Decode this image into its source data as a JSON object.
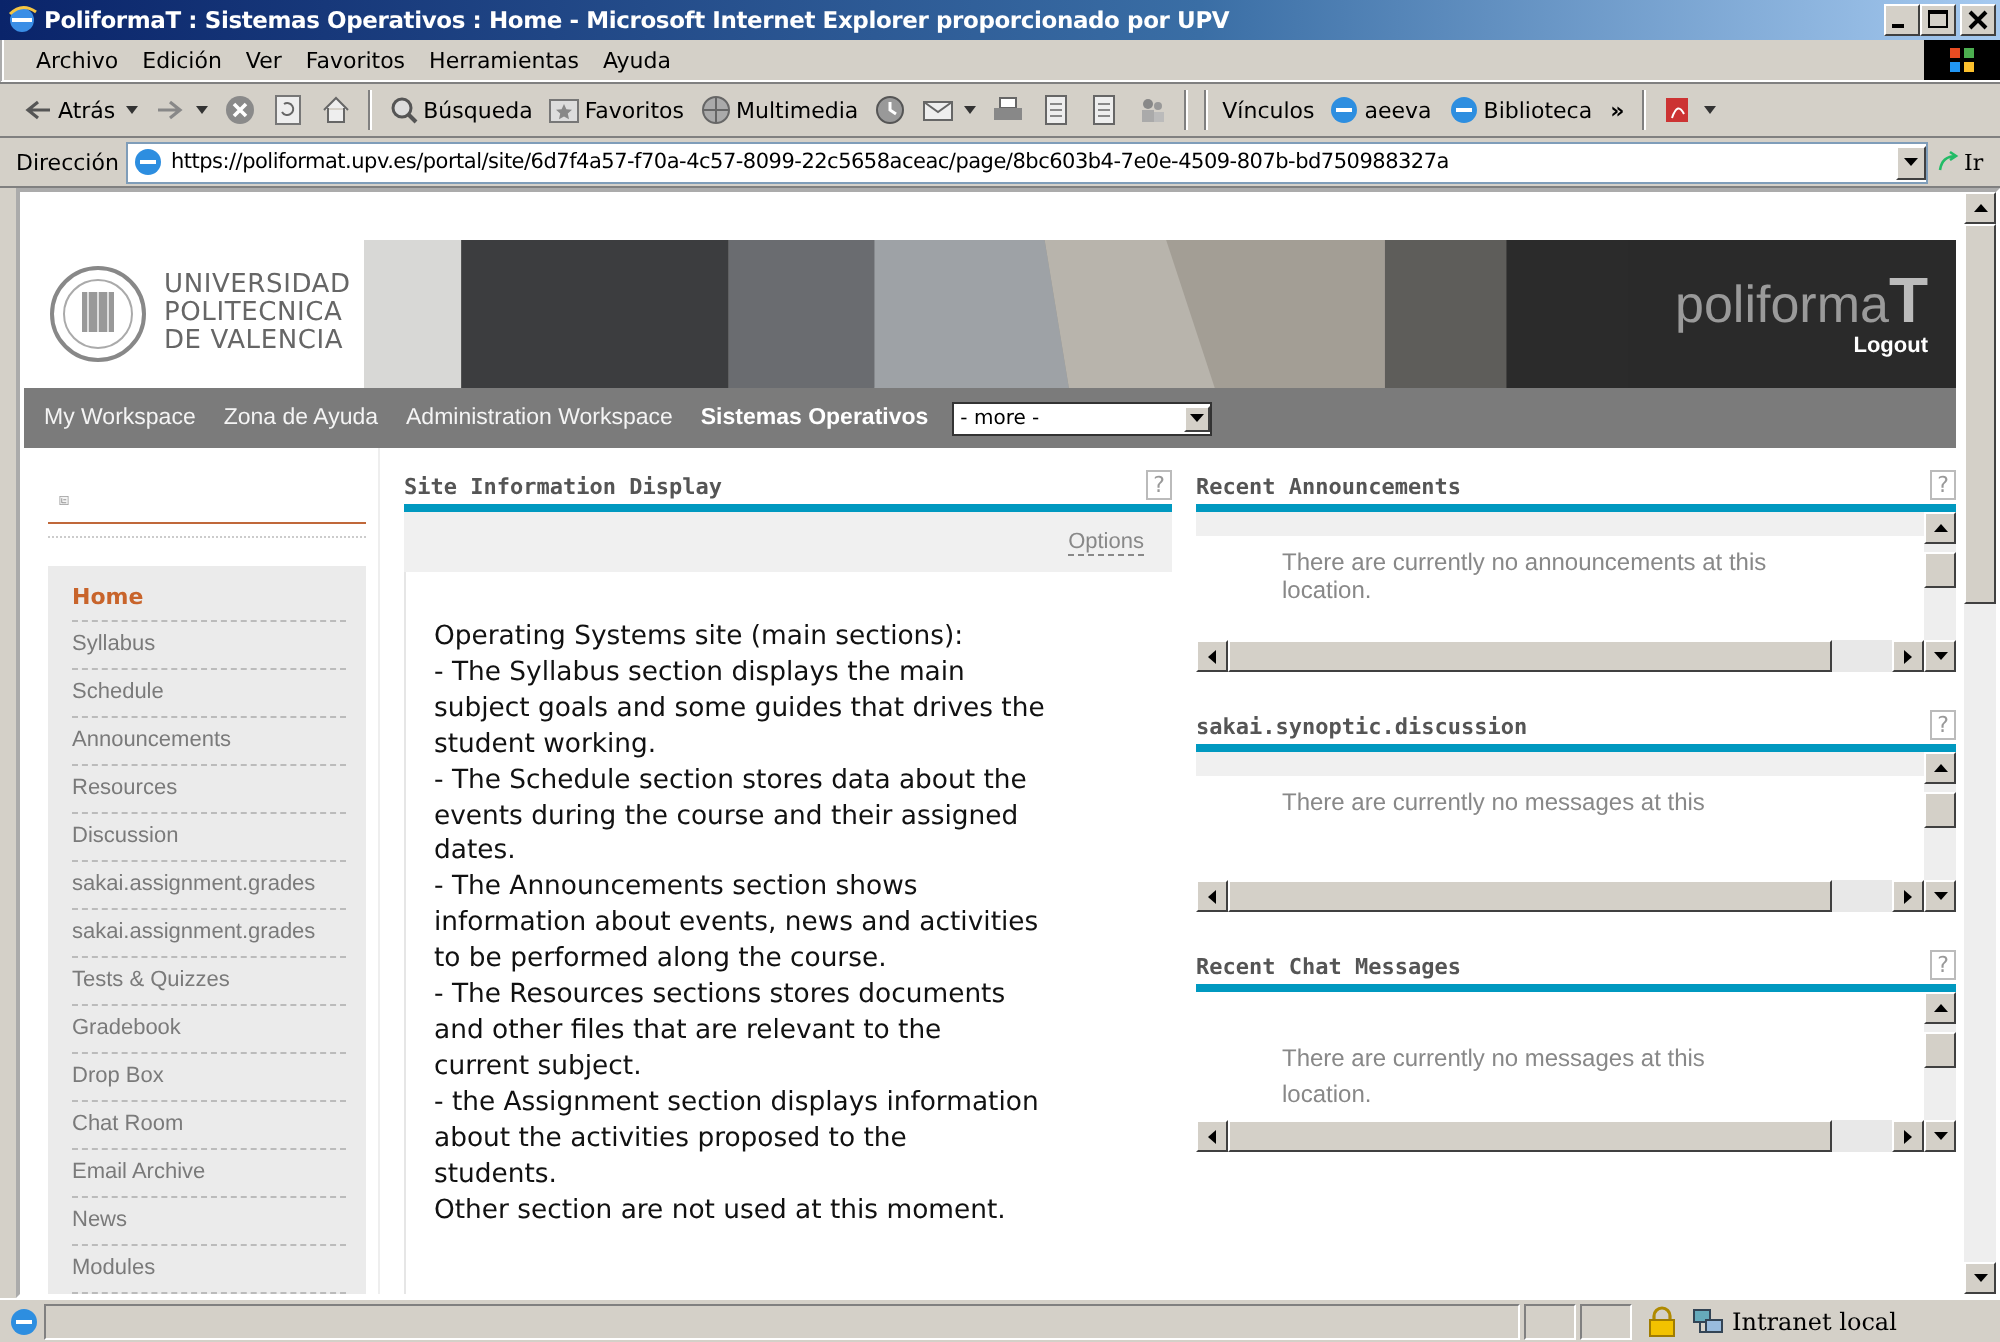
{
  "window": {
    "title": "PoliformaT : Sistemas Operativos : Home - Microsoft Internet Explorer proporcionado por UPV"
  },
  "menu": [
    "Archivo",
    "Edición",
    "Ver",
    "Favoritos",
    "Herramientas",
    "Ayuda"
  ],
  "toolbar": [
    {
      "kind": "back",
      "label": "Atrás",
      "dropdown": true
    },
    {
      "kind": "forward",
      "dropdown": true
    },
    {
      "kind": "stop"
    },
    {
      "kind": "refresh"
    },
    {
      "kind": "home"
    },
    {
      "kind": "search",
      "label": "Búsqueda"
    },
    {
      "kind": "favorites",
      "label": "Favoritos"
    },
    {
      "kind": "media",
      "label": "Multimedia"
    },
    {
      "kind": "history"
    },
    {
      "kind": "mail",
      "dropdown": true
    },
    {
      "kind": "print"
    },
    {
      "kind": "edit"
    },
    {
      "kind": "discuss"
    },
    {
      "kind": "messenger"
    }
  ],
  "links": {
    "label": "Vínculos",
    "items": [
      "aeeva",
      "Biblioteca"
    ],
    "more": "»"
  },
  "address": {
    "label": "Dirección",
    "value": "https://poliformat.upv.es/portal/site/6d7f4a57-f70a-4c57-8099-22c5658aceac/page/8bc603b4-7e0e-4509-807b-bd750988327a",
    "go": "Ir"
  },
  "banner": {
    "university": [
      "UNIVERSIDAD",
      "POLITECNICA",
      "DE VALENCIA"
    ],
    "brand": "poliforma**T**",
    "logout": "Logout"
  },
  "site_tabs": [
    {
      "label": "My Workspace",
      "selected": false
    },
    {
      "label": "Zona de Ayuda",
      "selected": false
    },
    {
      "label": "Administration Workspace",
      "selected": false
    },
    {
      "label": "Sistemas Operativos",
      "selected": true
    }
  ],
  "more_select": {
    "value": "- more -"
  },
  "tool_menu": [
    {
      "label": "Home",
      "selected": true
    },
    {
      "label": "Syllabus",
      "selected": false
    },
    {
      "label": "Schedule",
      "selected": false
    },
    {
      "label": "Announcements",
      "selected": false
    },
    {
      "label": "Resources",
      "selected": false
    },
    {
      "label": "Discussion",
      "selected": false
    },
    {
      "label": "sakai.assignment.grades",
      "selected": false
    },
    {
      "label": "sakai.assignment.grades",
      "selected": false
    },
    {
      "label": "Tests & Quizzes",
      "selected": false
    },
    {
      "label": "Gradebook",
      "selected": false
    },
    {
      "label": "Drop Box",
      "selected": false
    },
    {
      "label": "Chat Room",
      "selected": false
    },
    {
      "label": "Email Archive",
      "selected": false
    },
    {
      "label": "News",
      "selected": false
    },
    {
      "label": "Modules",
      "selected": false
    }
  ],
  "main_portlet": {
    "title": "Site Information Display",
    "help": "?",
    "options": "Options",
    "text": "Operating Systems site (main sections):\n- The Syllabus section displays the main\nsubject goals and some guides that drives the\nstudent working.\n- The Schedule section stores data about the\nevents during the course and their assigned\ndates.\n- The Announcements section shows\ninformation about events, news and activities\nto be performed along the course.\n- The Resources sections stores documents\nand other files that are relevant to the\ncurrent subject.\n- the Assignment section displays information\nabout the activities proposed to the\nstudents.\nOther section are not used at this moment."
  },
  "side_portlets": [
    {
      "title": "Recent Announcements",
      "help": "?",
      "message": "There are currently no announcements at this\nlocation.",
      "options_bar": true
    },
    {
      "title": "sakai.synoptic.discussion",
      "help": "?",
      "message": "There are currently no messages at this",
      "options_bar": true
    },
    {
      "title": "Recent Chat Messages",
      "help": "?",
      "message": "There are currently no messages at this\nlocation.",
      "options_bar": false
    }
  ],
  "status_bar": {
    "zone": "Intranet local"
  }
}
